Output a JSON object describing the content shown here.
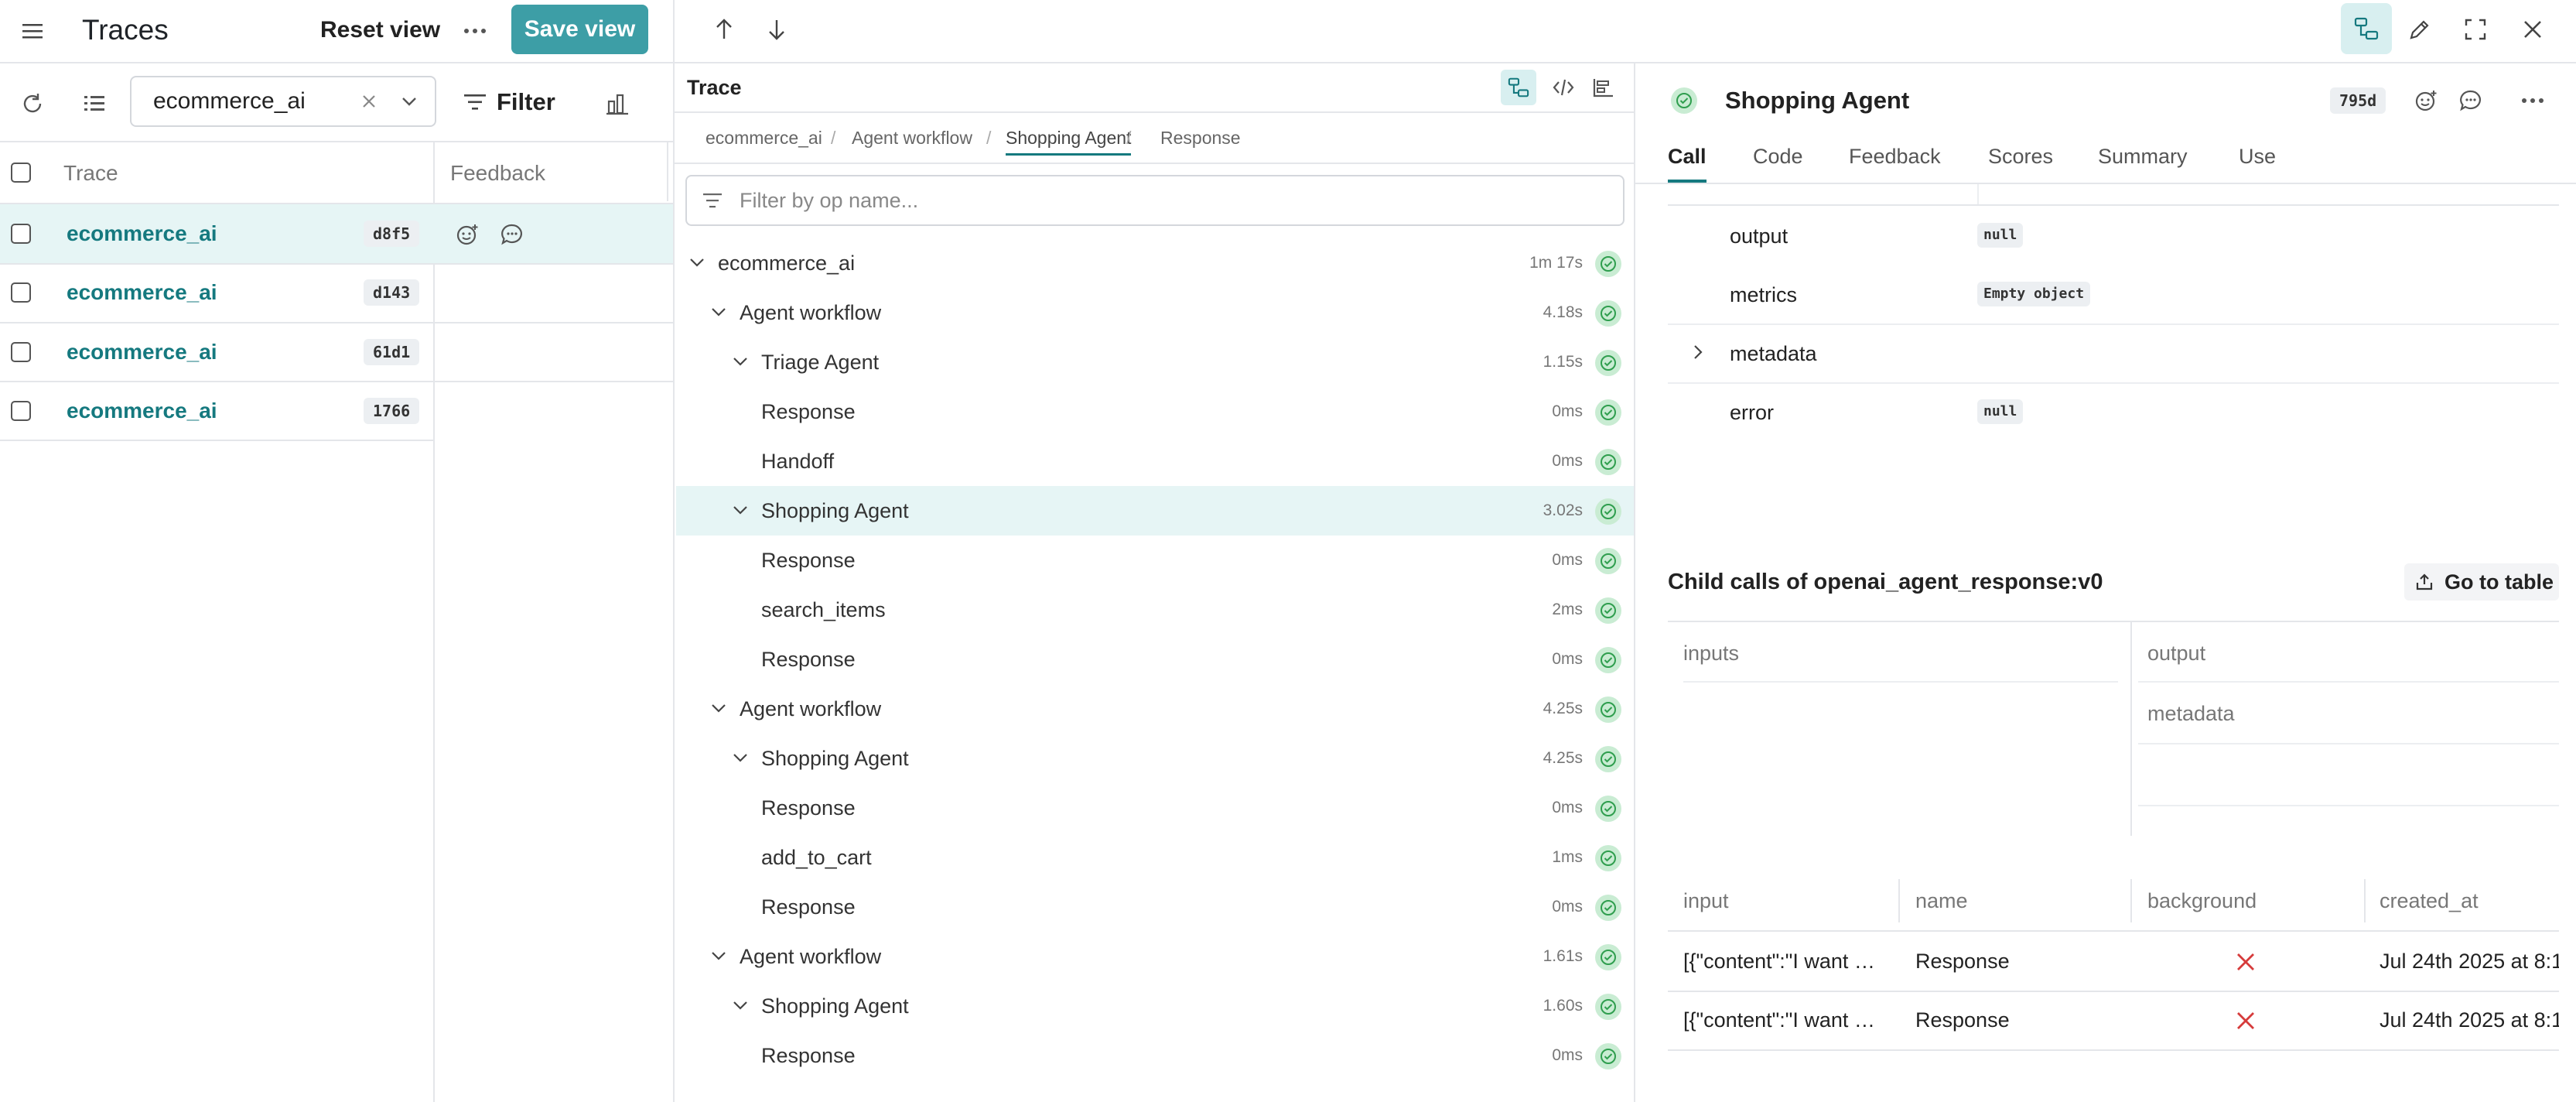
{
  "left_panel": {
    "title": "Traces",
    "reset_view": "Reset view",
    "save_view": "Save view",
    "search_value": "ecommerce_ai",
    "filter_label": "Filter",
    "columns": {
      "trace": "Trace",
      "feedback": "Feedback"
    },
    "rows": [
      {
        "name": "ecommerce_ai",
        "id": "d8f5"
      },
      {
        "name": "ecommerce_ai",
        "id": "d143"
      },
      {
        "name": "ecommerce_ai",
        "id": "61d1"
      },
      {
        "name": "ecommerce_ai",
        "id": "1766"
      }
    ]
  },
  "trace_panel": {
    "title": "Trace",
    "breadcrumb": [
      "ecommerce_ai",
      "Agent workflow",
      "Shopping Agent",
      "Response"
    ],
    "filter_placeholder": "Filter by op name...",
    "tree": [
      {
        "label": "ecommerce_ai",
        "duration": "1m 17s",
        "level": 0,
        "expanded": true
      },
      {
        "label": "Agent workflow",
        "duration": "4.18s",
        "level": 1,
        "expanded": true
      },
      {
        "label": "Triage Agent",
        "duration": "1.15s",
        "level": 2,
        "expanded": true
      },
      {
        "label": "Response",
        "duration": "0ms",
        "level": 3
      },
      {
        "label": "Handoff",
        "duration": "0ms",
        "level": 3
      },
      {
        "label": "Shopping Agent",
        "duration": "3.02s",
        "level": 2,
        "expanded": true,
        "selected": true
      },
      {
        "label": "Response",
        "duration": "0ms",
        "level": 3
      },
      {
        "label": "search_items",
        "duration": "2ms",
        "level": 3
      },
      {
        "label": "Response",
        "duration": "0ms",
        "level": 3
      },
      {
        "label": "Agent workflow",
        "duration": "4.25s",
        "level": 1,
        "expanded": true
      },
      {
        "label": "Shopping Agent",
        "duration": "4.25s",
        "level": 2,
        "expanded": true
      },
      {
        "label": "Response",
        "duration": "0ms",
        "level": 3
      },
      {
        "label": "add_to_cart",
        "duration": "1ms",
        "level": 3
      },
      {
        "label": "Response",
        "duration": "0ms",
        "level": 3
      },
      {
        "label": "Agent workflow",
        "duration": "1.61s",
        "level": 1,
        "expanded": true
      },
      {
        "label": "Shopping Agent",
        "duration": "1.60s",
        "level": 2,
        "expanded": true
      },
      {
        "label": "Response",
        "duration": "0ms",
        "level": 3
      }
    ]
  },
  "detail_panel": {
    "title": "Shopping Agent",
    "id_badge": "795d",
    "tabs": [
      "Call",
      "Code",
      "Feedback",
      "Scores",
      "Summary",
      "Use"
    ],
    "active_tab": "Call",
    "fields": [
      {
        "key": "output",
        "value": "null"
      },
      {
        "key": "metrics",
        "value": "Empty object"
      },
      {
        "key": "metadata",
        "value": ""
      },
      {
        "key": "error",
        "value": "null"
      }
    ],
    "child_calls_title": "Child calls of openai_agent_response:v0",
    "go_to_table": "Go to table",
    "group_headers": {
      "inputs": "inputs",
      "output": "output",
      "metadata": "metadata"
    },
    "columns": [
      "input",
      "name",
      "background",
      "created_at"
    ],
    "rows": [
      {
        "input": "[{\"content\":\"I want …",
        "name": "Response",
        "background": "false",
        "created_at": "Jul 24th 2025 at 8:1"
      },
      {
        "input": "[{\"content\":\"I want …",
        "name": "Response",
        "background": "false",
        "created_at": "Jul 24th 2025 at 8:1"
      }
    ]
  },
  "colors": {
    "accent": "#15797f",
    "save_button": "#3d9ea6",
    "selected_row": "#e6f5f5",
    "status_green": "#2f9e4e",
    "error_red": "#d63b3b"
  }
}
